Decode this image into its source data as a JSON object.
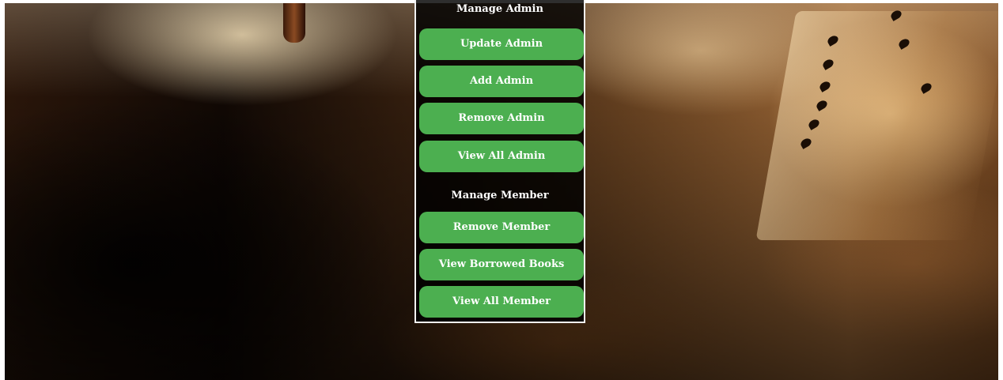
{
  "admin_section": {
    "title": "Manage Admin",
    "buttons": [
      "Update Admin",
      "Add Admin",
      "Remove Admin",
      "View All Admin"
    ]
  },
  "member_section": {
    "title": "Manage Member",
    "buttons": [
      "Remove Member",
      "View Borrowed Books",
      "View All Member"
    ]
  },
  "colors": {
    "button_background": "#4caf50",
    "button_text": "#ffffff",
    "panel_border": "#f2f2f2"
  }
}
